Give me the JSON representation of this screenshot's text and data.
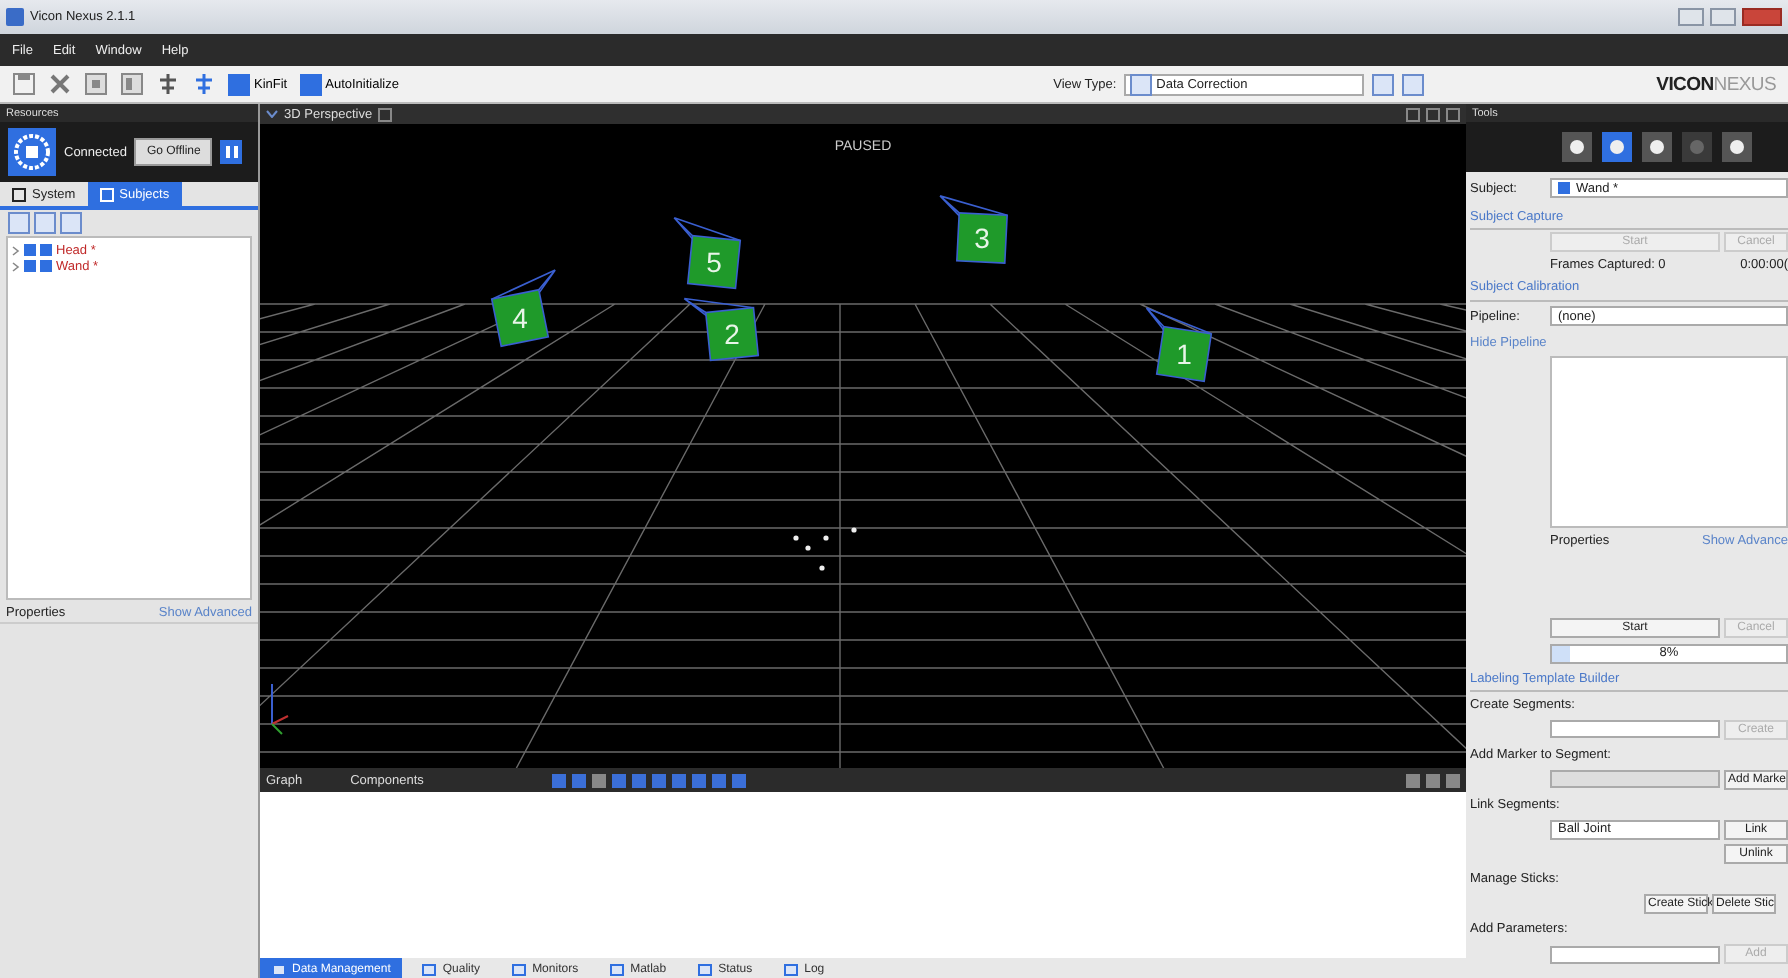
{
  "window": {
    "title": "Vicon Nexus 2.1.1"
  },
  "menu": [
    "File",
    "Edit",
    "Window",
    "Help"
  ],
  "toolbar": {
    "buttons": [
      "KinFit",
      "AutoInitialize"
    ],
    "view_type_label": "View Type:",
    "view_type": "Data Correction",
    "logo_bold": "VICON",
    "logo_light": "NEXUS"
  },
  "resources": {
    "title": "Resources",
    "status": "Connected",
    "button": "Go Offline",
    "tabs": [
      {
        "label": "System",
        "selected": false
      },
      {
        "label": "Subjects",
        "selected": true
      }
    ],
    "subjects": [
      {
        "name": "Head *",
        "checked": true
      },
      {
        "name": "Wand *",
        "checked": true
      }
    ],
    "properties": "Properties",
    "show_advanced": "Show Advanced"
  },
  "viewport": {
    "title": "3D Perspective",
    "status": "PAUSED",
    "cameras": [
      "4",
      "5",
      "2",
      "3",
      "1"
    ]
  },
  "graph": {
    "tabs": [
      "Graph",
      "Components"
    ]
  },
  "bottom_tabs": [
    {
      "label": "Data Management",
      "selected": true
    },
    {
      "label": "Quality",
      "selected": false
    },
    {
      "label": "Monitors",
      "selected": false
    },
    {
      "label": "Matlab",
      "selected": false
    },
    {
      "label": "Status",
      "selected": false
    },
    {
      "label": "Log",
      "selected": false
    }
  ],
  "tools": {
    "title": "Tools",
    "tabs": [
      {
        "selected": false,
        "disabled": false
      },
      {
        "selected": true,
        "disabled": false
      },
      {
        "selected": false,
        "disabled": false
      },
      {
        "selected": false,
        "disabled": true
      },
      {
        "selected": false,
        "disabled": false
      }
    ],
    "subject_label": "Subject:",
    "subject": "Wand *",
    "subject_capture": "Subject Capture",
    "capture_start": {
      "label": "Start",
      "disabled": true
    },
    "capture_cancel": {
      "label": "Cancel",
      "disabled": true
    },
    "frames": "Frames Captured: 0",
    "time": "0:00:00(",
    "subject_calibration": "Subject Calibration",
    "pipeline_label": "Pipeline:",
    "pipeline": "(none)",
    "hide_pipeline": "Hide Pipeline",
    "properties": "Properties",
    "show_advanced": "Show Advance",
    "calib_start": {
      "label": "Start",
      "disabled": false
    },
    "calib_cancel": {
      "label": "Cancel",
      "disabled": true
    },
    "progress": {
      "level": 0.08,
      "reading": "8%"
    },
    "labeling": "Labeling Template Builder",
    "create_segments": "Create Segments:",
    "create": {
      "label": "Create",
      "disabled": true
    },
    "add_marker": "Add Marker to Segment:",
    "add_marker_button": {
      "label": "Add Marke",
      "disabled": false
    },
    "link_segments": "Link Segments:",
    "joint": "Ball Joint",
    "link": {
      "label": "Link",
      "disabled": false
    },
    "unlink": {
      "label": "Unlink",
      "disabled": false
    },
    "manage_sticks": "Manage Sticks:",
    "create_stick": {
      "label": "Create Stick",
      "disabled": false
    },
    "delete_stick": {
      "label": "Delete Stic",
      "disabled": false
    },
    "add_parameters": "Add Parameters:",
    "add": {
      "label": "Add",
      "disabled": true
    }
  }
}
